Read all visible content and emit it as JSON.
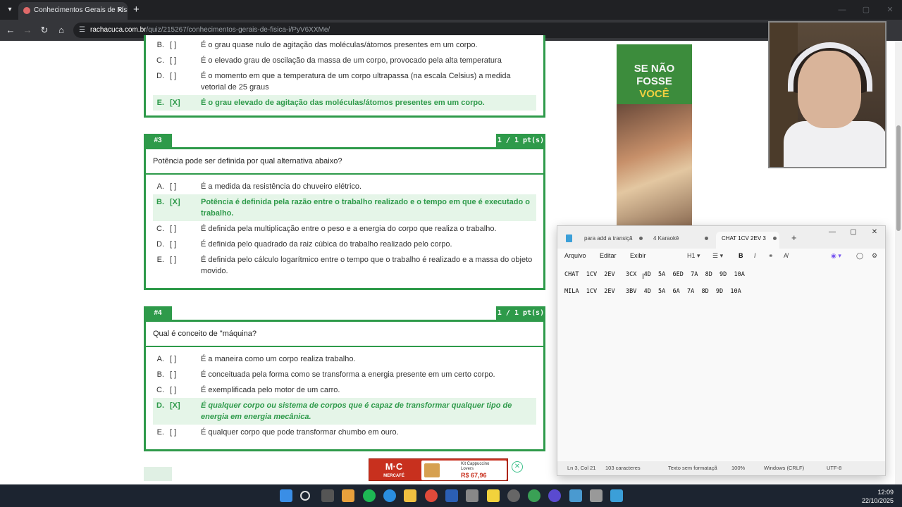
{
  "browser": {
    "tab_title": "Conhecimentos Gerais de Física",
    "url_host": "rachacuca.com.br",
    "url_path": "/quiz/215267/conhecimentos-gerais-de-fisica-i/PyV6XXMe/"
  },
  "quiz": {
    "partial": {
      "options": [
        {
          "letter": "B.",
          "mark": "[ ]",
          "text": "É o grau quase nulo de agitação das moléculas/átomos presentes em um corpo."
        },
        {
          "letter": "C.",
          "mark": "[ ]",
          "text": "É o elevado grau de oscilação da massa de um corpo, provocado pela alta temperatura"
        },
        {
          "letter": "D.",
          "mark": "[ ]",
          "text": "É o momento em que a temperatura de um corpo ultrapassa (na escala Celsius) a medida vetorial de 25 graus"
        },
        {
          "letter": "E.",
          "mark": "[X]",
          "text": "É o grau elevado de agitação das moléculas/átomos presentes em um corpo.",
          "correct": true
        }
      ]
    },
    "q3": {
      "number": "#3",
      "score": "1 / 1 pt(s)",
      "question": "Potência pode ser definida por qual alternativa abaixo?",
      "options": [
        {
          "letter": "A.",
          "mark": "[ ]",
          "text": "É a medida da resistência do chuveiro elétrico."
        },
        {
          "letter": "B.",
          "mark": "[X]",
          "text": "Potência é definida pela razão entre o trabalho realizado e o tempo em que é executado o trabalho.",
          "correct": true
        },
        {
          "letter": "C.",
          "mark": "[ ]",
          "text": "É definida pela multiplicação entre o peso e a energia do corpo que realiza o trabalho."
        },
        {
          "letter": "D.",
          "mark": "[ ]",
          "text": "É definida pelo quadrado da raiz cúbica do trabalho realizado pelo corpo."
        },
        {
          "letter": "E.",
          "mark": "[ ]",
          "text": "É definida pelo cálculo logarítmico entre o tempo que o trabalho é realizado e a massa do objeto movido."
        }
      ]
    },
    "q4": {
      "number": "#4",
      "score": "1 / 1 pt(s)",
      "question": "Qual é conceito de \"máquina?",
      "options": [
        {
          "letter": "A.",
          "mark": "[ ]",
          "text": "É a maneira como um corpo realiza trabalho."
        },
        {
          "letter": "B.",
          "mark": "[ ]",
          "text": "É conceituada pela forma como se transforma a energia presente em um certo corpo."
        },
        {
          "letter": "C.",
          "mark": "[ ]",
          "text": "É exemplificada pelo motor de um carro."
        },
        {
          "letter": "D.",
          "mark": "[X]",
          "text": "É qualquer corpo ou sistema de corpos que é capaz de transformar qualquer tipo de energia em energia mecânica.",
          "correct": true
        },
        {
          "letter": "E.",
          "mark": "[ ]",
          "text": "É qualquer corpo que pode transformar chumbo em ouro."
        }
      ]
    }
  },
  "ad": {
    "line1": "SE NÃO FOSSE",
    "line2": "VOCÊ",
    "bottom_brand": "M·C",
    "bottom_brand_sub": "MERCAFÉ",
    "bottom_product": "Kit Cappuccino Lovers",
    "bottom_price": "R$ 67,96"
  },
  "notepad": {
    "tabs": [
      "para add a transiçã",
      "4 Karaokê",
      "CHAT 1CV 2EV 3"
    ],
    "menu": [
      "Arquivo",
      "Editar",
      "Exibir"
    ],
    "heading_select": "H1",
    "lines": [
      "CHAT  1CV  2EV   3CX  4D  5A  6ED  7A  8D  9D  10A",
      "MILA  1CV  2EV   3BV  4D  5A  6A  7A  8D  9D  10A"
    ],
    "status": {
      "position": "Ln 3, Col 21",
      "chars": "103 caracteres",
      "format": "Texto sem formataçã",
      "zoom": "100%",
      "eol": "Windows (CRLF)",
      "encoding": "UTF-8"
    }
  },
  "taskbar": {
    "time": "12:09",
    "date": "22/10/2025"
  },
  "colors": {
    "accent_green": "#2e9a4a",
    "correct_bg": "#e5f5e8"
  }
}
